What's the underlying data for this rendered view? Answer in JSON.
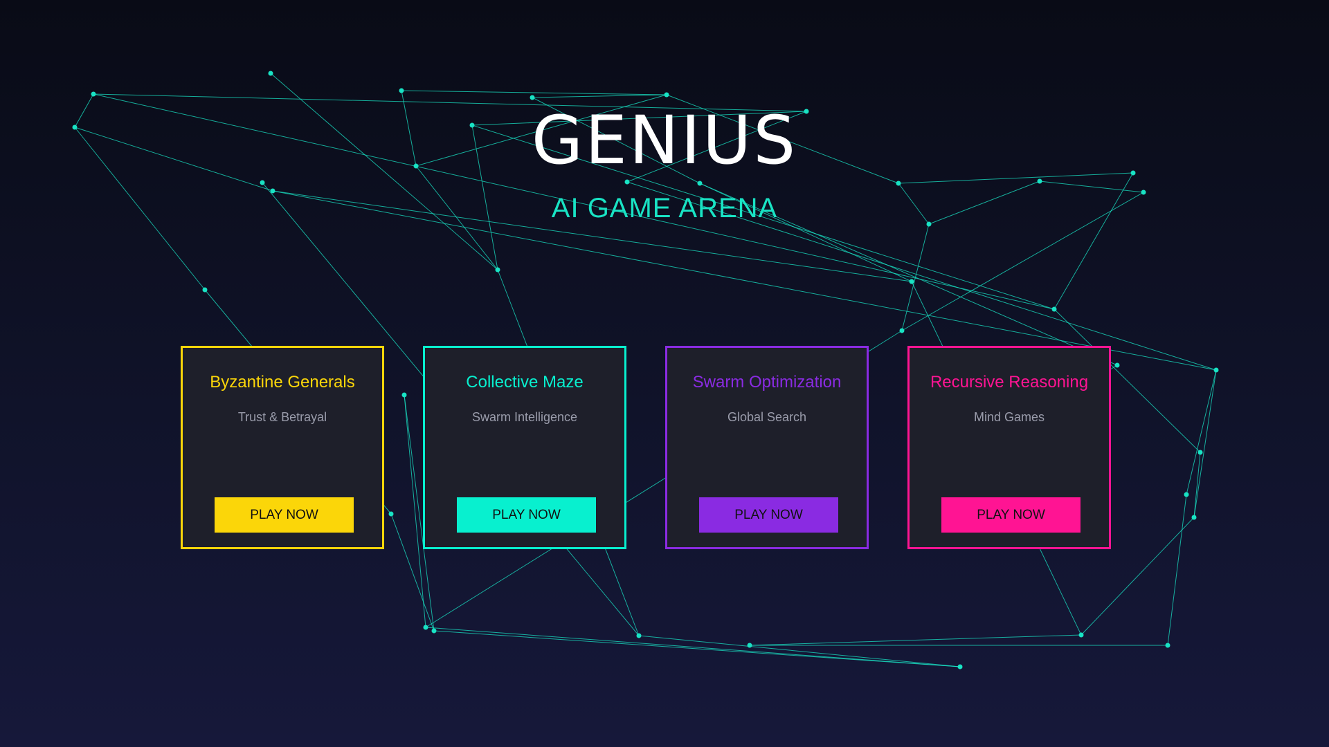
{
  "hero": {
    "title": "GENIUS",
    "subtitle": "AI GAME ARENA",
    "title_color": "#ffffff",
    "subtitle_color": "#19e3c4"
  },
  "network_color": "#19e3c4",
  "cards": [
    {
      "title": "Byzantine Generals",
      "subtitle": "Trust & Betrayal",
      "button": "PLAY NOW",
      "accent": "#fbd609",
      "button_text_color": "#111111"
    },
    {
      "title": "Collective Maze",
      "subtitle": "Swarm Intelligence",
      "button": "PLAY NOW",
      "accent": "#08f0cf",
      "button_text_color": "#111111"
    },
    {
      "title": "Swarm Optimization",
      "subtitle": "Global Search",
      "button": "PLAY NOW",
      "accent": "#8a2be2",
      "button_text_color": "#111111"
    },
    {
      "title": "Recursive Reasoning",
      "subtitle": "Mind Games",
      "button": "PLAY NOW",
      "accent": "#ff1493",
      "button_text_color": "#111111"
    }
  ]
}
